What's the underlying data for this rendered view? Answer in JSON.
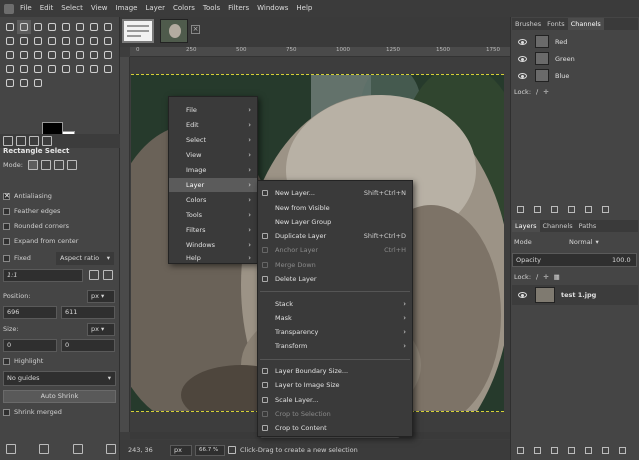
{
  "menubar": {
    "items": [
      "File",
      "Edit",
      "Select",
      "View",
      "Image",
      "Layer",
      "Colors",
      "Tools",
      "Filters",
      "Windows",
      "Help"
    ]
  },
  "tool_options": {
    "title": "Rectangle Select",
    "mode_label": "Mode:",
    "antialiasing": "Antialiasing",
    "feather_edges": "Feather edges",
    "rounded_corners": "Rounded corners",
    "expand_from_center": "Expand from center",
    "fixed_label": "Fixed",
    "fixed_option": "Aspect ratio",
    "ratio_value": "1:1",
    "position_label": "Position:",
    "position_unit": "px",
    "position_x": "696",
    "position_y": "611",
    "size_label": "Size:",
    "size_unit": "px",
    "size_w": "0",
    "size_h": "0",
    "highlight": "Highlight",
    "guides": "No guides",
    "auto_shrink": "Auto Shrink",
    "shrink_merged": "Shrink merged"
  },
  "ruler": {
    "marks": [
      "0",
      "250",
      "500",
      "750",
      "1000",
      "1250",
      "1500",
      "1750"
    ]
  },
  "status": {
    "coords": "243, 36",
    "unit": "px",
    "zoom": "66.7 %",
    "message": "Click-Drag to create a new selection"
  },
  "dock_top": {
    "tabs": [
      "Brushes",
      "Fonts",
      "Channels"
    ],
    "channels": [
      "Red",
      "Green",
      "Blue"
    ],
    "lock_label": "Lock:"
  },
  "dock_layers": {
    "tabs": [
      "Layers",
      "Channels",
      "Paths"
    ],
    "mode_label": "Mode",
    "mode_value": "Normal",
    "opacity_label": "Opacity",
    "opacity_value": "100.0",
    "lock_label": "Lock:",
    "layer_name": "test 1.jpg"
  },
  "context_menu": {
    "items": [
      "File",
      "Edit",
      "Select",
      "View",
      "Image",
      "Layer",
      "Colors",
      "Tools",
      "Filters",
      "Windows",
      "Help"
    ],
    "highlighted": "Layer"
  },
  "layer_submenu": {
    "group1": [
      {
        "label": "New Layer...",
        "shortcut": "Shift+Ctrl+N"
      },
      {
        "label": "New from Visible",
        "shortcut": ""
      },
      {
        "label": "New Layer Group",
        "shortcut": ""
      },
      {
        "label": "Duplicate Layer",
        "shortcut": "Shift+Ctrl+D"
      },
      {
        "label": "Anchor Layer",
        "shortcut": "Ctrl+H"
      },
      {
        "label": "Merge Down",
        "shortcut": ""
      },
      {
        "label": "Delete Layer",
        "shortcut": ""
      }
    ],
    "group2": [
      "Stack",
      "Mask",
      "Transparency",
      "Transform"
    ],
    "group3": [
      "Layer Boundary Size...",
      "Layer to Image Size",
      "Scale Layer...",
      "Crop to Selection",
      "Crop to Content"
    ]
  },
  "colors": {
    "selection_marquee": "#d6cf36",
    "menu_highlight": "#5b5b5b"
  }
}
